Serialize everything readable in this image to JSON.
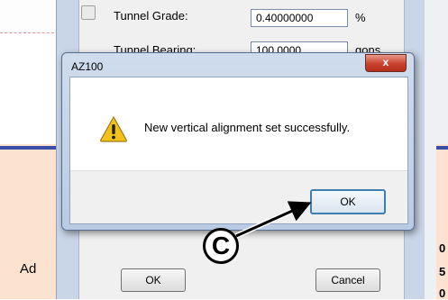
{
  "background": {
    "left_text": "Ad",
    "right_texts": [
      "0",
      "5",
      "0"
    ]
  },
  "parent_dialog": {
    "rows": [
      {
        "label": "Tunnel Grade:",
        "value": "0.40000000",
        "unit": "%"
      },
      {
        "label": "Tunnel Bearing:",
        "value": "100.0000",
        "unit": "gons"
      }
    ],
    "ok_label": "OK",
    "cancel_label": "Cancel"
  },
  "message_box": {
    "title": "AZ100",
    "close_label": "x",
    "icon": "warning-icon",
    "message": "New vertical alignment set successfully.",
    "ok_label": "OK"
  },
  "annotation": {
    "callout_label": "C"
  },
  "colors": {
    "accent": "#3c7fb1",
    "close_red": "#c9412c",
    "frame_blue": "#c9d6e8",
    "warning_yellow": "#f2c21a"
  }
}
